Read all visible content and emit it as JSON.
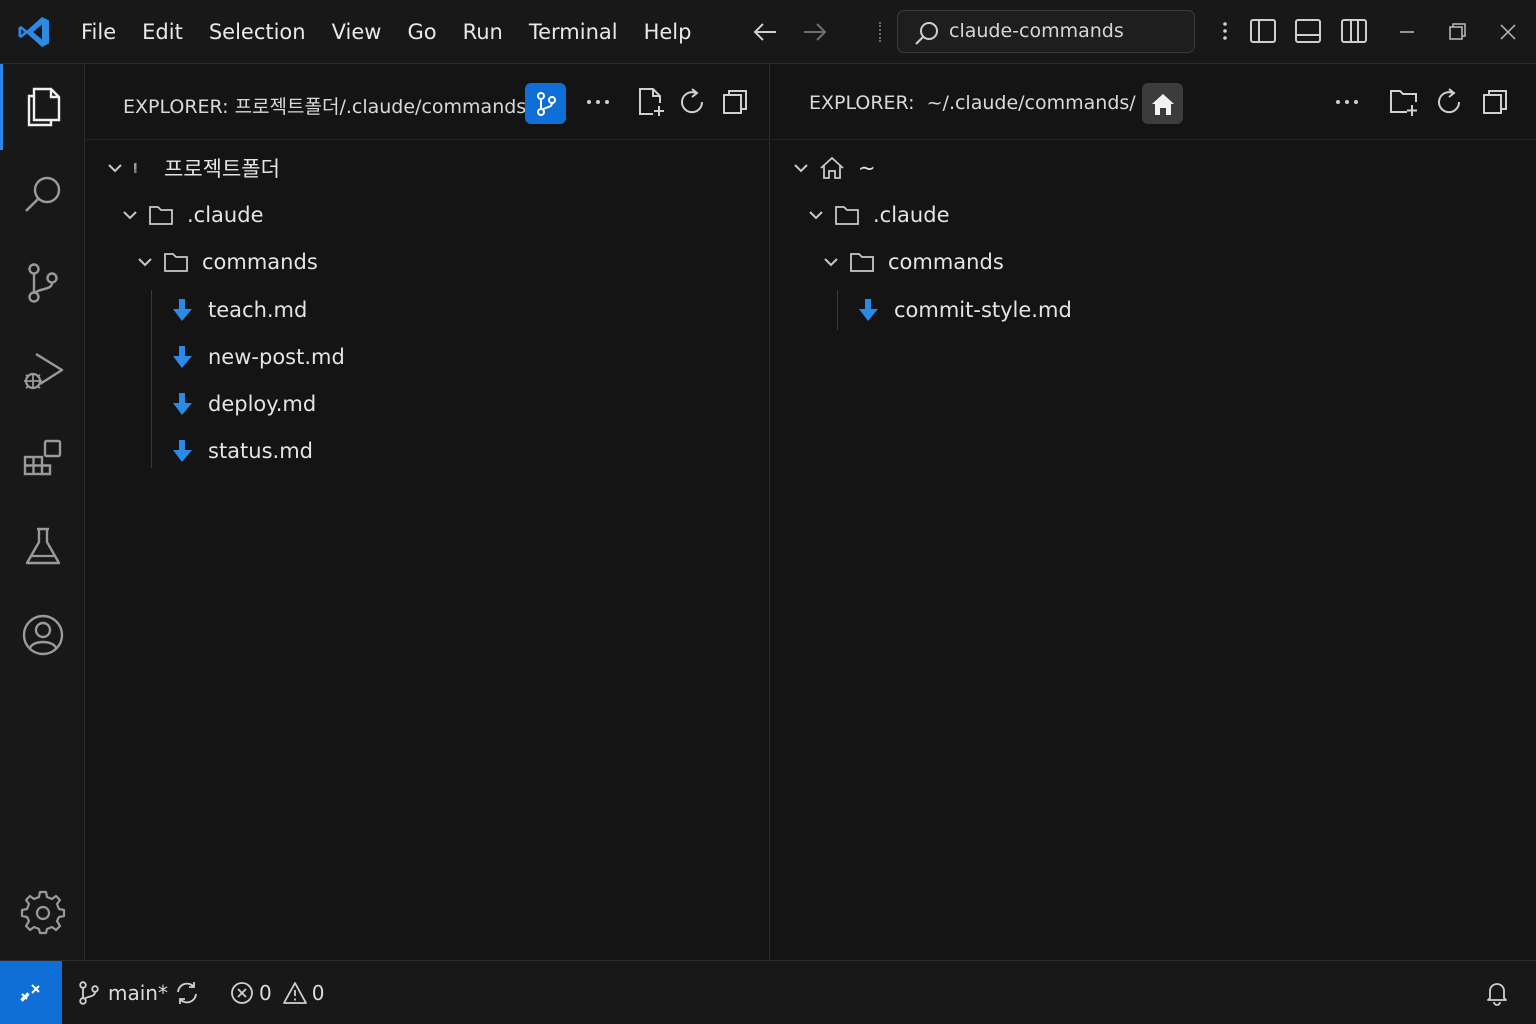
{
  "app": {
    "menu": [
      "File",
      "Edit",
      "Selection",
      "View",
      "Go",
      "Run",
      "Terminal",
      "Help"
    ],
    "command_center": "claude-commands"
  },
  "left_explorer": {
    "label": "EXPLORER:",
    "path": "프로젝트폴더/.claude/commands/",
    "root": "프로젝트폴더",
    "folder1": ".claude",
    "folder2": "commands",
    "files": [
      "teach.md",
      "new-post.md",
      "deploy.md",
      "status.md"
    ]
  },
  "right_explorer": {
    "label": "EXPLORER:",
    "path": "~/.claude/commands/",
    "root": "~",
    "folder1": ".claude",
    "folder2": "commands",
    "files": [
      "commit-style.md"
    ]
  },
  "status": {
    "branch": "main*",
    "errors": "0",
    "warnings": "0"
  },
  "colors": {
    "accent": "#0f6fd6",
    "file_icon": "#2a8ae6",
    "home_badge": "#3c3c3c"
  },
  "icons": {
    "activity": [
      "files-icon",
      "search-icon",
      "source-control-icon",
      "run-debug-icon",
      "extensions-icon",
      "testing-icon",
      "account-icon",
      "settings-gear-icon"
    ]
  }
}
